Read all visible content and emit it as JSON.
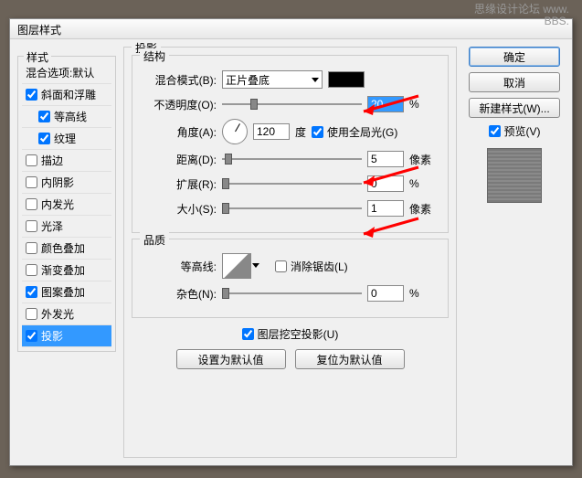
{
  "watermark": {
    "line1": "思缘设计论坛 www.",
    "line2": "BBS."
  },
  "dialog": {
    "title": "图层样式"
  },
  "leftPanel": {
    "header": "样式",
    "blend": "混合选项:默认",
    "items": [
      {
        "label": "斜面和浮雕",
        "checked": true
      },
      {
        "label": "等高线",
        "checked": true,
        "indent": true
      },
      {
        "label": "纹理",
        "checked": true,
        "indent": true
      },
      {
        "label": "描边",
        "checked": false
      },
      {
        "label": "内阴影",
        "checked": false
      },
      {
        "label": "内发光",
        "checked": false
      },
      {
        "label": "光泽",
        "checked": false
      },
      {
        "label": "颜色叠加",
        "checked": false
      },
      {
        "label": "渐变叠加",
        "checked": false
      },
      {
        "label": "图案叠加",
        "checked": true
      },
      {
        "label": "外发光",
        "checked": false
      },
      {
        "label": "投影",
        "checked": true,
        "selected": true
      }
    ]
  },
  "main": {
    "title": "投影",
    "structure": {
      "label": "结构",
      "blendMode": {
        "label": "混合模式(B):",
        "value": "正片叠底"
      },
      "opacity": {
        "label": "不透明度(O):",
        "value": "20",
        "unit": "%"
      },
      "angle": {
        "label": "角度(A):",
        "value": "120",
        "unit": "度",
        "globalLight": "使用全局光(G)"
      },
      "distance": {
        "label": "距离(D):",
        "value": "5",
        "unit": "像素"
      },
      "spread": {
        "label": "扩展(R):",
        "value": "0",
        "unit": "%"
      },
      "size": {
        "label": "大小(S):",
        "value": "1",
        "unit": "像素"
      }
    },
    "quality": {
      "label": "品质",
      "contour": {
        "label": "等高线:",
        "antialias": "消除锯齿(L)"
      },
      "noise": {
        "label": "杂色(N):",
        "value": "0",
        "unit": "%"
      }
    },
    "knockout": "图层挖空投影(U)",
    "setDefault": "设置为默认值",
    "resetDefault": "复位为默认值"
  },
  "right": {
    "ok": "确定",
    "cancel": "取消",
    "newStyle": "新建样式(W)...",
    "preview": "预览(V)"
  }
}
